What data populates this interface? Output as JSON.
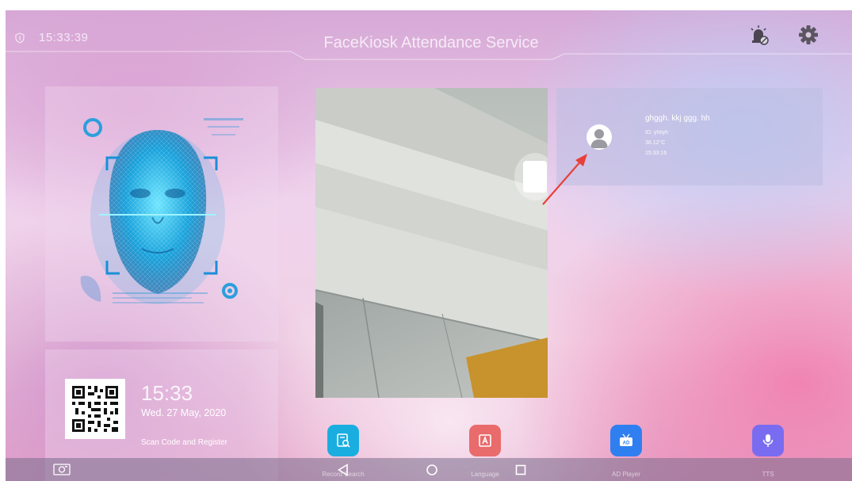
{
  "status_bar": {
    "time": "15:33:39",
    "icons": [
      "shield-icon",
      "alarm-off-icon",
      "gear-icon"
    ]
  },
  "header": {
    "title": "FaceKiosk Attendance Service"
  },
  "face_panel": {
    "icons": [
      "face-scan-graphic"
    ]
  },
  "register_panel": {
    "clock": "15:33",
    "date": "Wed. 27 May, 2020",
    "scan_label": "Scan Code and Register",
    "icons": [
      "qr-code-icon"
    ]
  },
  "record": {
    "name": "ghggh.  kkj  ggg.  hh",
    "id": "ID: yhtiyh",
    "temperature": "36.12°C",
    "time": "15:33:16",
    "icons": [
      "avatar-icon"
    ]
  },
  "features": [
    {
      "label": "Record Search",
      "icon": "record-search-icon",
      "color": "#1aaee0"
    },
    {
      "label": "Language",
      "icon": "language-icon",
      "color": "#e96b6b"
    },
    {
      "label": "AD Player",
      "icon": "ad-player-icon",
      "color": "#2f7ff0"
    },
    {
      "label": "TTS",
      "icon": "microphone-icon",
      "color": "#7a6cf0"
    }
  ],
  "nav": {
    "icons": [
      "camera-icon",
      "back-icon",
      "home-icon",
      "recents-icon"
    ]
  },
  "colors": {
    "annotation_arrow": "#e8403a"
  }
}
